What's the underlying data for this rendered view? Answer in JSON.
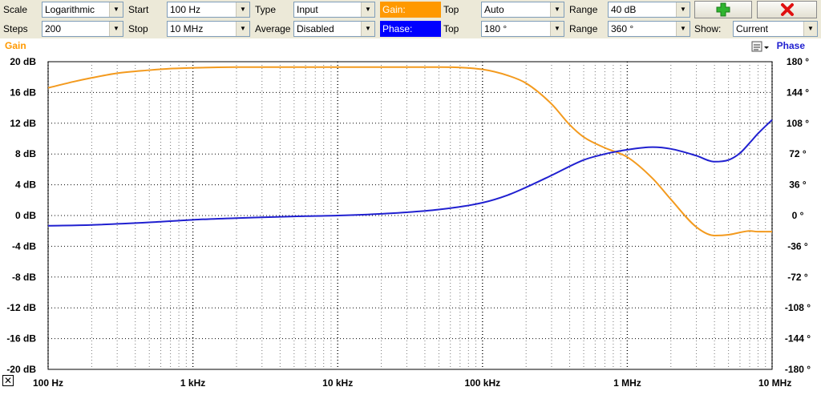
{
  "toolbar": {
    "scale_label": "Scale",
    "scale_value": "Logarithmic",
    "start_label": "Start",
    "start_value": "100 Hz",
    "type_label": "Type",
    "type_value": "Input",
    "gain_swatch": "Gain:",
    "gain_top_label": "Top",
    "gain_top_value": "Auto",
    "gain_range_label": "Range",
    "gain_range_value": "40 dB",
    "steps_label": "Steps",
    "steps_value": "200",
    "stop_label": "Stop",
    "stop_value": "10 MHz",
    "average_label": "Average",
    "average_value": "Disabled",
    "phase_swatch": "Phase:",
    "phase_top_label": "Top",
    "phase_top_value": "180 °",
    "phase_range_label": "Range",
    "phase_range_value": "360 °",
    "show_label": "Show:",
    "show_value": "Current",
    "add_icon": "plus-icon",
    "delete_icon": "x-icon"
  },
  "colors": {
    "gain": "#ff9900",
    "gain_trace": "#f39a1e",
    "phase": "#0000ff",
    "phase_trace": "#2020d0",
    "grid": "#000000",
    "toolbar_bg": "#ece9d8"
  },
  "chart_data": {
    "type": "line",
    "x_scale": "log",
    "x_ticks": [
      "100 Hz",
      "1 kHz",
      "10 kHz",
      "100 kHz",
      "1 MHz",
      "10 MHz"
    ],
    "xlim": [
      100,
      10000000
    ],
    "left_axis_label": "Gain",
    "right_axis_label": "Phase",
    "y_ticks_left": [
      "20 dB",
      "16 dB",
      "12 dB",
      "8 dB",
      "4 dB",
      "0 dB",
      "-4 dB",
      "-8 dB",
      "-12 dB",
      "-16 dB",
      "-20 dB"
    ],
    "y_ticks_right": [
      "180 °",
      "144 °",
      "108 °",
      "72 °",
      "36 °",
      "0 °",
      "-36 °",
      "-72 °",
      "-108 °",
      "-144 °",
      "-180 °"
    ],
    "ylim_left": [
      -20,
      20
    ],
    "ylim_right": [
      -180,
      180
    ],
    "grid": true,
    "series": [
      {
        "name": "Gain",
        "axis": "left",
        "color": "#f39a1e",
        "x": [
          100,
          150,
          200,
          300,
          500,
          700,
          1000,
          2000,
          5000,
          10000,
          20000,
          50000,
          100000,
          150000,
          200000,
          300000,
          400000,
          500000,
          700000,
          1000000,
          1500000,
          2000000,
          3000000,
          4000000,
          5000000,
          6000000,
          7000000,
          8000000,
          10000000
        ],
        "values": [
          16.6,
          17.4,
          17.9,
          18.5,
          18.9,
          19.1,
          19.2,
          19.3,
          19.3,
          19.3,
          19.3,
          19.3,
          19.0,
          18.2,
          17.2,
          14.5,
          11.8,
          10.2,
          8.8,
          7.6,
          4.8,
          2.1,
          -1.5,
          -2.6,
          -2.5,
          -2.2,
          -2.0,
          -2.1,
          -2.1
        ]
      },
      {
        "name": "Phase",
        "axis": "right",
        "color": "#2020d0",
        "x": [
          100,
          200,
          500,
          1000,
          2000,
          5000,
          10000,
          20000,
          50000,
          100000,
          150000,
          200000,
          300000,
          500000,
          700000,
          1000000,
          1500000,
          2000000,
          3000000,
          4000000,
          5000000,
          6000000,
          7000000,
          8000000,
          10000000
        ],
        "values": [
          -12,
          -11,
          -8,
          -5,
          -3,
          -1,
          0,
          2,
          7,
          15,
          24,
          33,
          47,
          65,
          72,
          77,
          80,
          78,
          70,
          63,
          65,
          73,
          85,
          96,
          112
        ]
      }
    ]
  }
}
